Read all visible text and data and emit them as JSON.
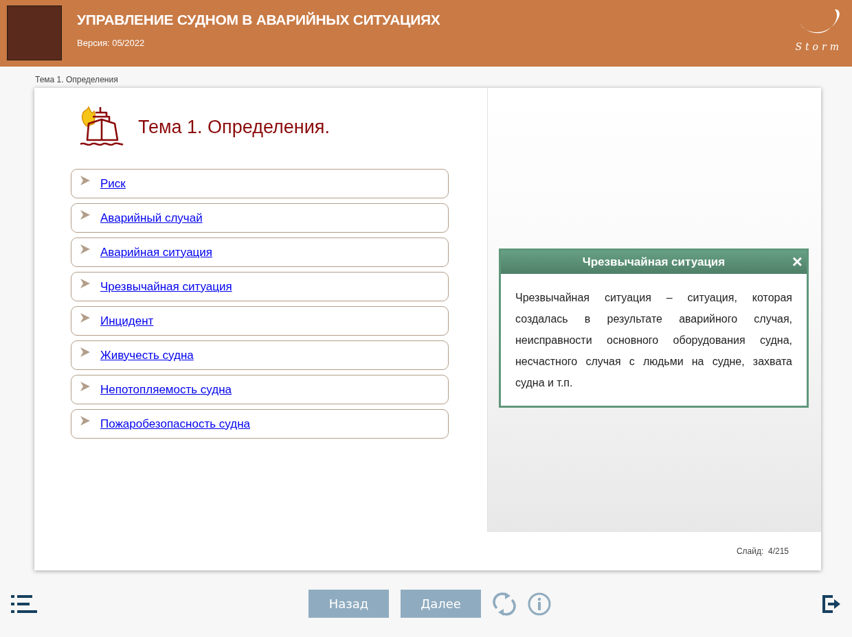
{
  "header": {
    "title": "УПРАВЛЕНИЕ СУДНОМ В АВАРИЙНЫХ СИТУАЦИЯХ",
    "version": "Версия: 05/2022",
    "logo_text": "Storm"
  },
  "breadcrumb": "Тема 1. Определения",
  "slide": {
    "heading": "Тема 1. Определения.",
    "items": [
      {
        "label": "Риск"
      },
      {
        "label": "Аварийный случай"
      },
      {
        "label": "Аварийная ситуация"
      },
      {
        "label": "Чрезвычайная ситуация"
      },
      {
        "label": "Инцидент"
      },
      {
        "label": "Живучесть судна"
      },
      {
        "label": "Непотопляемость судна"
      },
      {
        "label": "Пожаробезопасность судна"
      }
    ],
    "popup": {
      "title": "Чрезвычайная ситуация",
      "close": "×",
      "text": "Чрезвычайная ситуация – ситуация, которая создалась в результате аварийного случая, неисправности основного оборудования судна, несчастного случая с людьми на судне, захвата судна и т.п."
    },
    "counter": "Слайд:  4/215"
  },
  "footer": {
    "buttons": [
      "Назад",
      "Далее"
    ]
  }
}
